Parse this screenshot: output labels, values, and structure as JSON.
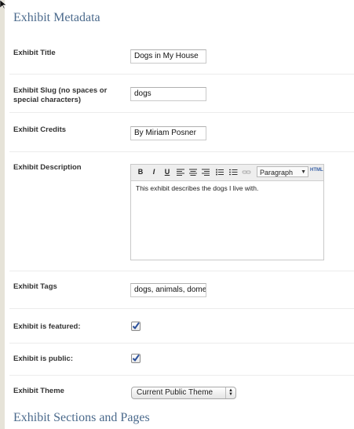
{
  "sections": {
    "metadata_title": "Exhibit Metadata",
    "pages_title": "Exhibit Sections and Pages"
  },
  "fields": {
    "title": {
      "label": "Exhibit Title",
      "value": "Dogs in My House"
    },
    "slug": {
      "label": "Exhibit Slug (no spaces or special characters)",
      "value": "dogs"
    },
    "credits": {
      "label": "Exhibit Credits",
      "value": "By Miriam Posner"
    },
    "description": {
      "label": "Exhibit Description",
      "value": "This exhibit describes the dogs I live with.",
      "toolbar": {
        "bold": "B",
        "italic": "I",
        "underline": "U",
        "format_select": "Paragraph",
        "html": "HTML"
      }
    },
    "tags": {
      "label": "Exhibit Tags",
      "value": "dogs, animals, dome"
    },
    "featured": {
      "label": "Exhibit is featured:",
      "checked": true
    },
    "public": {
      "label": "Exhibit is public:",
      "checked": true
    },
    "theme": {
      "label": "Exhibit Theme",
      "value": "Current Public Theme"
    }
  },
  "icons": {
    "cursor": "mouse-pointer-icon",
    "align_left": "align-left-icon",
    "align_center": "align-center-icon",
    "align_right": "align-right-icon",
    "bullet_list": "bullet-list-icon",
    "numbered_list": "numbered-list-icon",
    "link": "link-icon",
    "checkmark": "checkmark-icon"
  },
  "colors": {
    "heading": "#4b6a8c",
    "checkmark": "#2a4f9a"
  }
}
